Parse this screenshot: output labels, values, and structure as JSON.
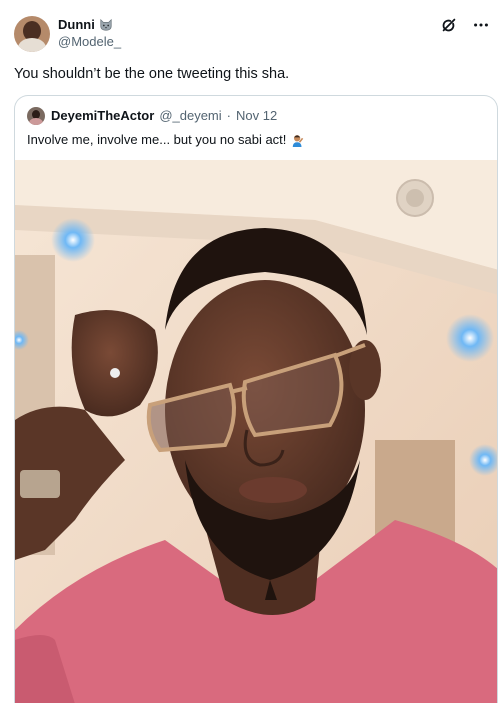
{
  "tweet": {
    "author_name": "Dunni",
    "author_emoji": "cat-face-emoji",
    "author_handle": "@Modele_",
    "text": "You shouldn’t be the one tweeting this sha.",
    "actions": {
      "grok_icon": "grok-icon",
      "more_icon": "more-icon"
    }
  },
  "quoted": {
    "name": "DeyemiTheActor",
    "handle": "@_deyemi",
    "separator": "·",
    "date": "Nov 12",
    "text": "Involve me, involve me... but you no sabi act!",
    "text_emoji": "person-facepalming-emoji",
    "photo": {
      "description_icon": "selfie-photo",
      "colors": {
        "shirt": "#d96a7e",
        "skin": "#5e3a2c",
        "wall": "#f1dcc8",
        "ceiling": "#f8ece0",
        "light": "#4aa3f0"
      }
    }
  },
  "colors": {
    "text": "#0f1419",
    "secondary": "#536471",
    "border": "#cfd9de",
    "background": "#ffffff"
  }
}
